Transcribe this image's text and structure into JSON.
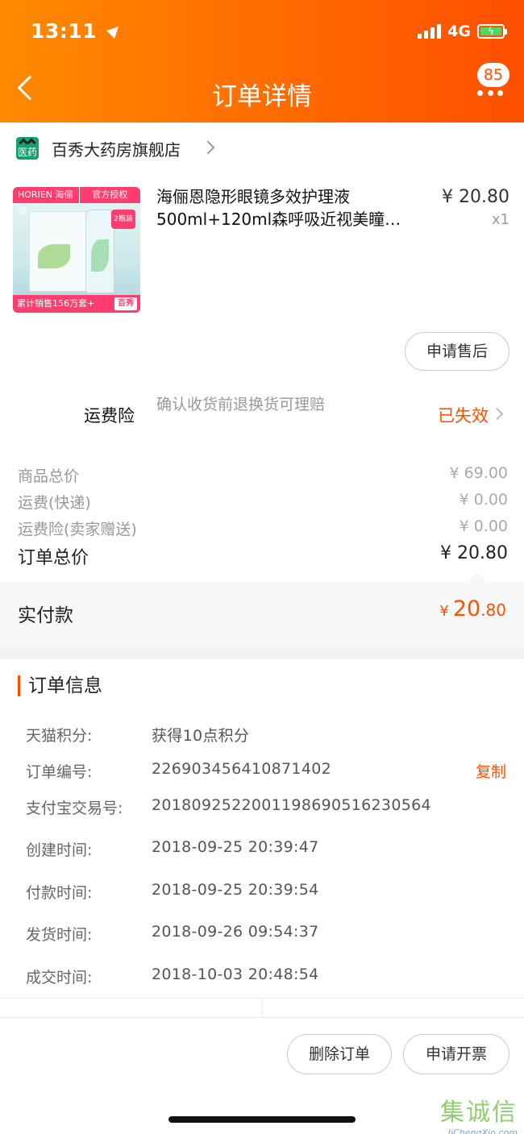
{
  "status_bar": {
    "time": "13:11",
    "network": "4G"
  },
  "header": {
    "title": "订单详情",
    "badge_count": "85"
  },
  "shop": {
    "logo_text": "医药",
    "name": "百秀大药房旗舰店"
  },
  "product": {
    "image_tag_left": "HORIEN 海俪恩",
    "image_tag_right": "官方授权",
    "image_badge": "2瓶装",
    "image_bottom_text": "累计销售156万套+",
    "image_bottom_brand": "百秀",
    "title": "海俪恩隐形眼镜多效护理液500ml+120ml森呼吸近视美瞳…",
    "price": "¥ 20.80",
    "qty": "x1",
    "after_sale_label": "申请售后"
  },
  "freight": {
    "label": "运费险",
    "desc": "确认收货前退换货可理赔",
    "status": "已失效"
  },
  "summary": [
    {
      "label": "商品总价",
      "value": "¥ 69.00"
    },
    {
      "label": "运费(快递)",
      "value": "¥ 0.00"
    },
    {
      "label": "运费险(卖家赠送)",
      "value": "¥ 0.00"
    },
    {
      "label": "订单总价",
      "value": "¥ 20.80"
    }
  ],
  "paid": {
    "label": "实付款",
    "currency": "¥",
    "integer": "20",
    "decimal": ".80"
  },
  "order_info": {
    "title": "订单信息",
    "rows": [
      {
        "label": "天猫积分:",
        "value": "获得10点积分"
      },
      {
        "label": "订单编号:",
        "value": "226903456410871402"
      },
      {
        "label": "支付宝交易号:",
        "value": "2018092522001198690516230564"
      },
      {
        "label": "创建时间:",
        "value": "2018-09-25 20:39:47"
      },
      {
        "label": "付款时间:",
        "value": "2018-09-25 20:39:54"
      },
      {
        "label": "发货时间:",
        "value": "2018-09-26 09:54:37"
      },
      {
        "label": "成交时间:",
        "value": "2018-10-03 20:48:54"
      }
    ],
    "copy_label": "复制"
  },
  "actions": {
    "delete_label": "删除订单",
    "invoice_label": "申请开票"
  },
  "watermark": {
    "cn": "集诚信",
    "en": "JiChengXin.com"
  }
}
